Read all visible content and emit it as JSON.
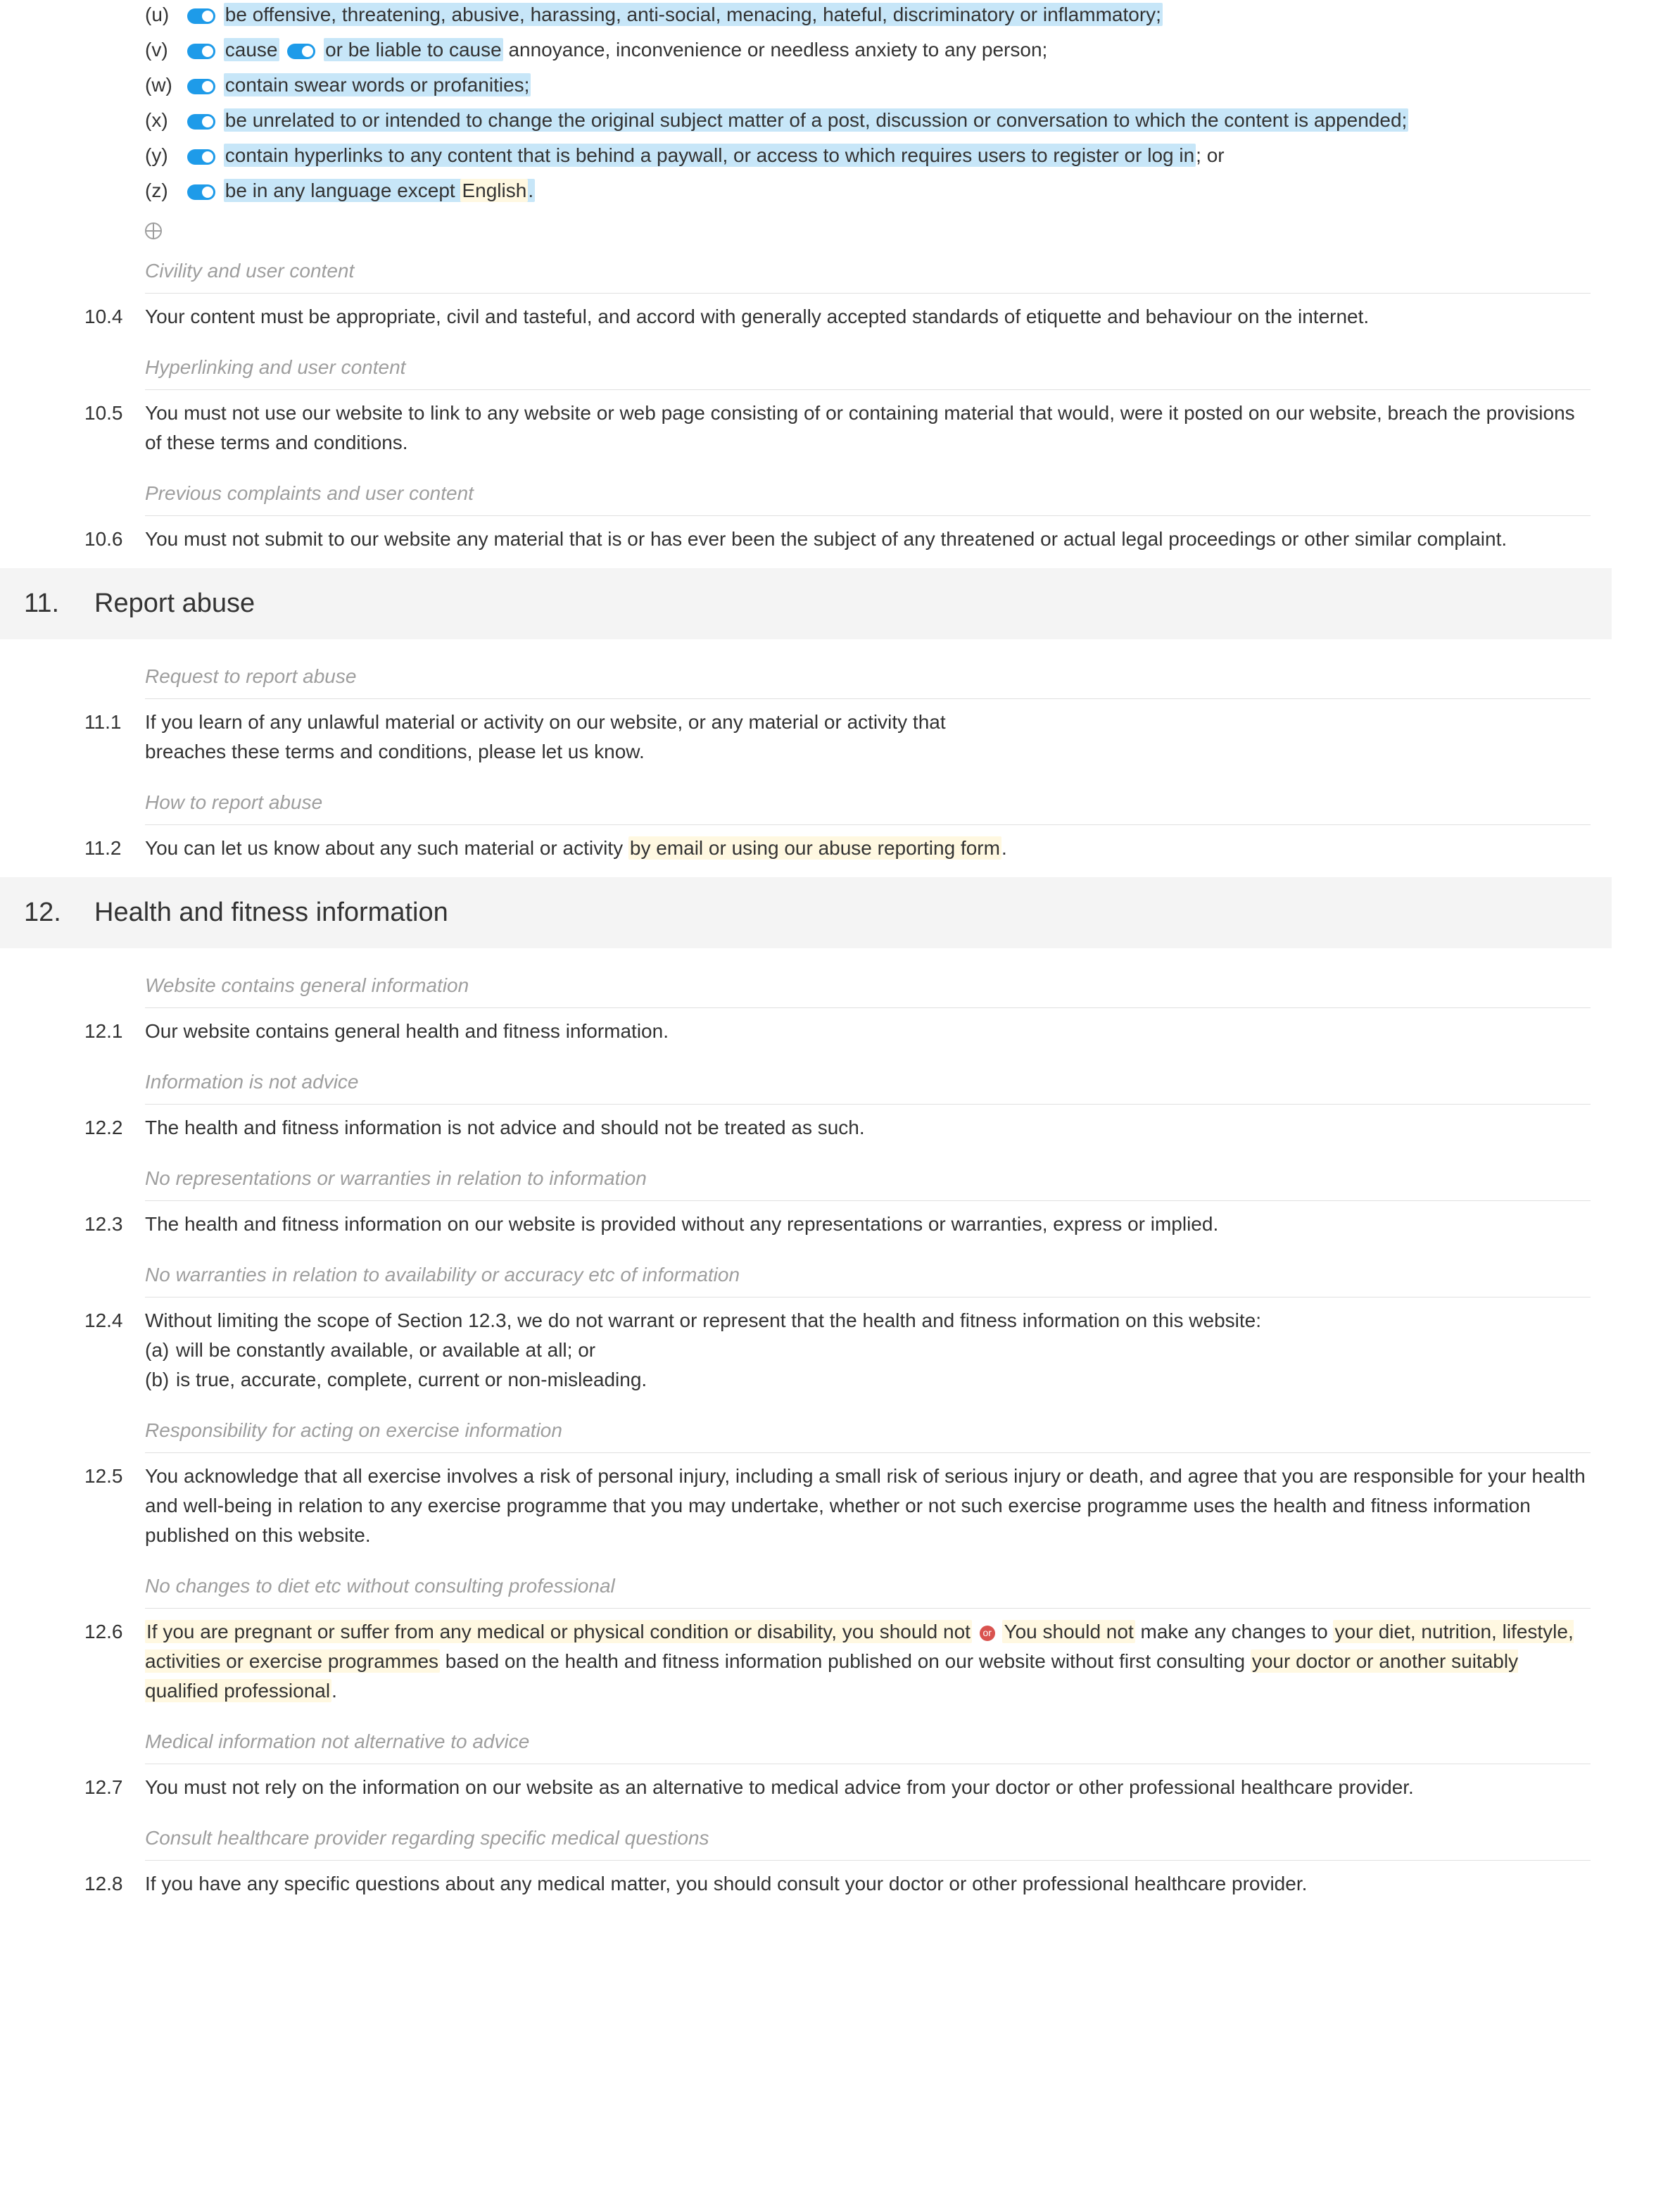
{
  "clauses10_3": {
    "u": {
      "letter": "(u)",
      "text": "be offensive, threatening, abusive, harassing, anti-social, menacing, hateful, discriminatory or inflammatory;"
    },
    "v": {
      "letter": "(v)",
      "pre": "cause",
      "mid": "or be liable to cause",
      "post": " annoyance, inconvenience or needless anxiety to any person;"
    },
    "w": {
      "letter": "(w)",
      "text": "contain swear words or profanities;"
    },
    "x": {
      "letter": "(x)",
      "text": "be unrelated to or intended to change the original subject matter of a post, discussion or conversation to which the content is appended;"
    },
    "y": {
      "letter": "(y)",
      "text": "contain hyperlinks to any content that is behind a paywall, or access to which requires users to register or log in",
      "tail": "; or"
    },
    "z": {
      "letter": "(z)",
      "pre": "be in any language except ",
      "lang": "English",
      "post": "."
    }
  },
  "hints": {
    "civility": "Civility and user content",
    "hyperlinking": "Hyperlinking and user content",
    "prevComplaints": "Previous complaints and user content",
    "reqReport": "Request to report abuse",
    "howReport": "How to report abuse",
    "genInfo": "Website contains general information",
    "notAdvice": "Information is not advice",
    "noReps": "No representations or warranties in relation to information",
    "noWarrAvail": "No warranties in relation to availability or accuracy etc of information",
    "respExercise": "Responsibility for acting on exercise information",
    "noDietChanges": "No changes to diet etc without consulting professional",
    "medNotAlt": "Medical information not alternative to advice",
    "consultHcp": "Consult healthcare provider regarding specific medical questions"
  },
  "n10_4": {
    "num": "10.4",
    "text": "Your content must be appropriate, civil and tasteful, and accord with generally accepted standards of etiquette and behaviour on the internet."
  },
  "n10_5": {
    "num": "10.5",
    "text": "You must not use our website to link to any website or web page consisting of or containing material that would, were it posted on our website, breach the provisions of these terms and conditions."
  },
  "n10_6": {
    "num": "10.6",
    "text": "You must not submit to our website any material that is or has ever been the subject of any threatened or actual legal proceedings or other similar complaint."
  },
  "sec11": {
    "num": "11.",
    "title": "Report abuse"
  },
  "n11_1": {
    "num": "11.1",
    "text": "If you learn of any unlawful material or activity on our website, or any material or activity that breaches these terms and conditions, please let us know."
  },
  "n11_2": {
    "num": "11.2",
    "pre": "You can let us know about any such material or activity ",
    "hl": "by email or using our abuse reporting form",
    "post": "."
  },
  "sec12": {
    "num": "12.",
    "title": "Health and fitness information"
  },
  "n12_1": {
    "num": "12.1",
    "text": "Our website contains general health and fitness information."
  },
  "n12_2": {
    "num": "12.2",
    "text": "The health and fitness information is not advice and should not be treated as such."
  },
  "n12_3": {
    "num": "12.3",
    "text": "The health and fitness information on our website is provided without any representations or warranties, express or implied."
  },
  "n12_4": {
    "num": "12.4",
    "intro": "Without limiting the scope of Section 12.3, we do not warrant or represent that the health and fitness information on this website:",
    "a": {
      "l": "(a)",
      "t": "will be constantly available, or available at all; or"
    },
    "b": {
      "l": "(b)",
      "t": "is true, accurate, complete, current or non-misleading."
    }
  },
  "n12_5": {
    "num": "12.5",
    "text": "You acknowledge that all exercise involves a risk of personal injury, including a small risk of serious injury or death, and agree that you are responsible for your health and well-being in relation to any exercise programme that you may undertake, whether or not such exercise programme uses the health and fitness information published on this website."
  },
  "n12_6": {
    "num": "12.6",
    "p1": "If you are pregnant or suffer from any medical or physical condition or disability, you should not",
    "or": "or",
    "p2a": "You should not",
    "p2b": " make any changes to ",
    "p3": "your diet, nutrition, lifestyle, activities or exercise programmes",
    "p4": " based on the health and fitness information published on our website without first consulting ",
    "p5": "your doctor or another suitably qualified professional",
    "p6": "."
  },
  "n12_7": {
    "num": "12.7",
    "text": "You must not rely on the information on our website as an alternative to medical advice from your doctor or other professional healthcare provider."
  },
  "n12_8": {
    "num": "12.8",
    "text": "If you have any specific questions about any medical matter, you should consult your doctor or other professional healthcare provider."
  }
}
